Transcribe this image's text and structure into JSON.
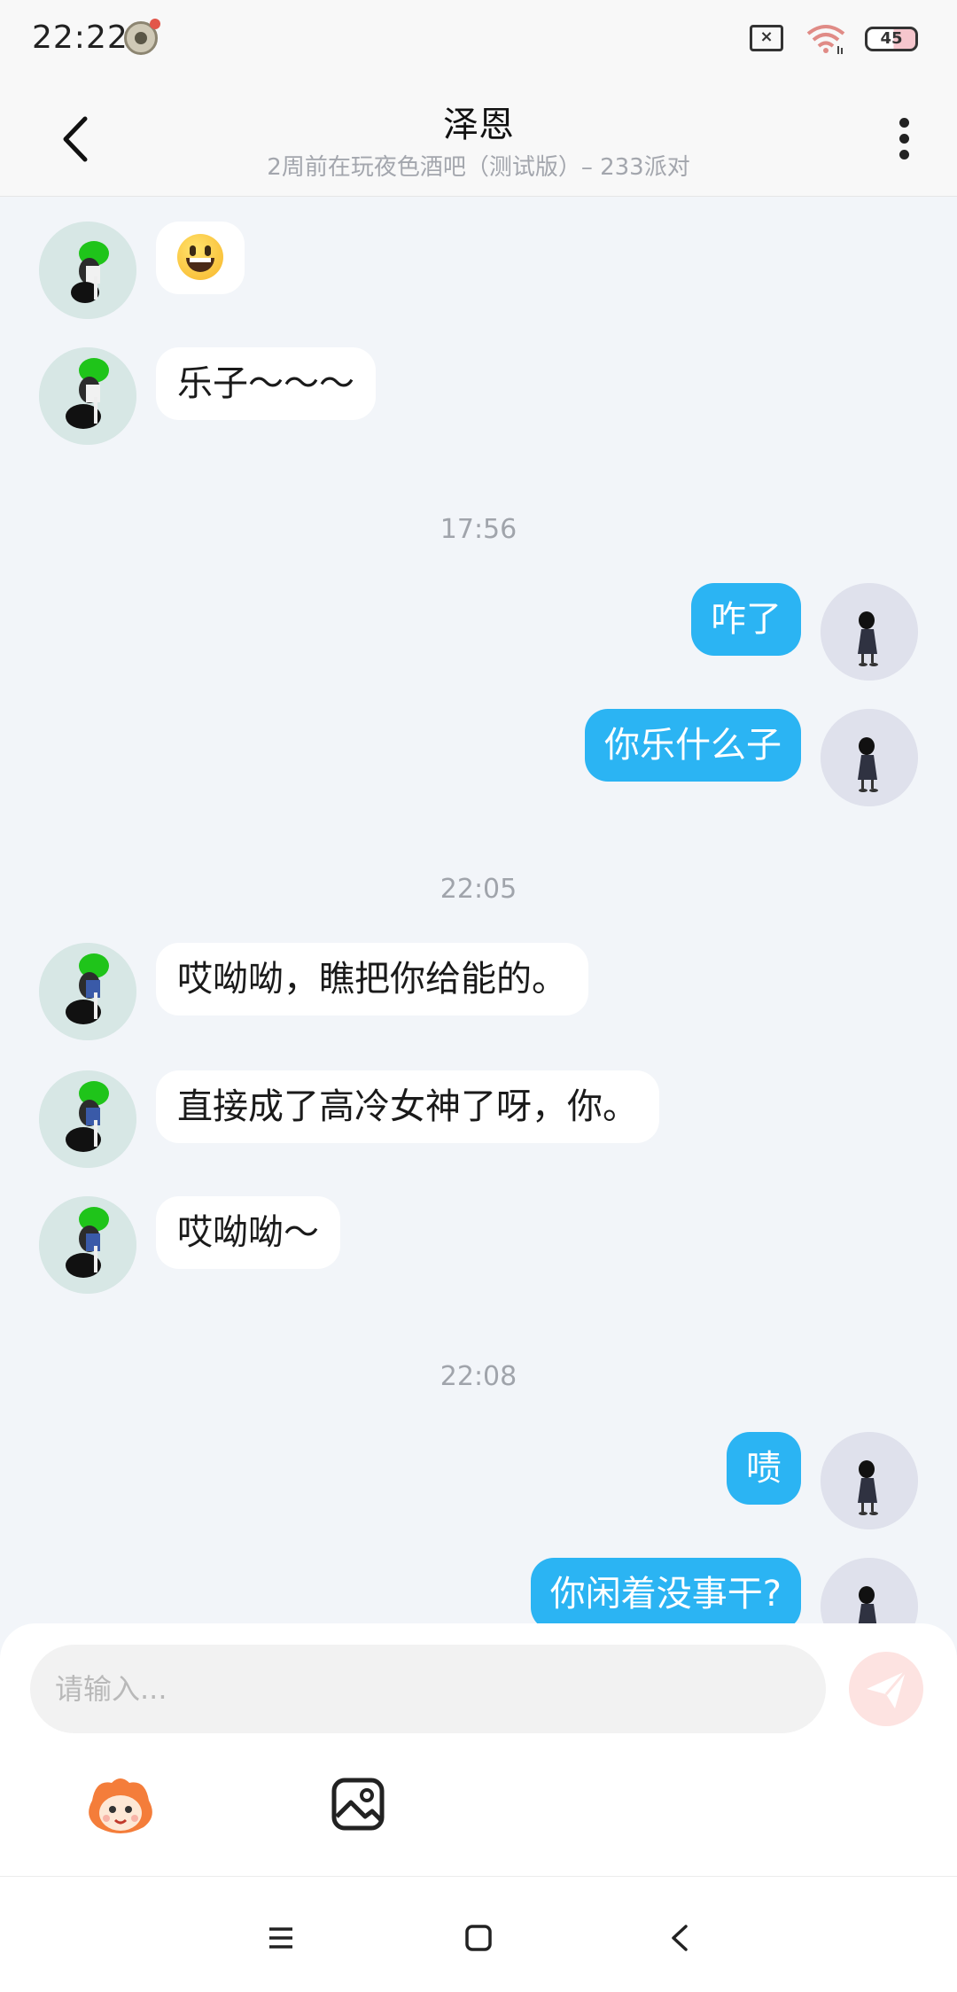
{
  "status_bar": {
    "time": "22:22",
    "battery": "45",
    "sim": "×"
  },
  "header": {
    "title": "泽恩",
    "subtitle": "2周前在玩夜色酒吧（测试版）– 233派对"
  },
  "messages": [
    {
      "side": "in",
      "kind": "emoji",
      "text": "",
      "icon": "grinning-face-emoji"
    },
    {
      "side": "in",
      "kind": "text",
      "text": "乐子～～～"
    },
    {
      "kind": "time",
      "text": "17:56"
    },
    {
      "side": "out",
      "kind": "text",
      "text": "咋了"
    },
    {
      "side": "out",
      "kind": "text",
      "text": "你乐什么子"
    },
    {
      "kind": "time",
      "text": "22:05"
    },
    {
      "side": "in",
      "kind": "text",
      "text": "哎呦呦，瞧把你给能的。"
    },
    {
      "side": "in",
      "kind": "text",
      "text": "直接成了高冷女神了呀，你。"
    },
    {
      "side": "in",
      "kind": "text",
      "text": "哎呦呦～"
    },
    {
      "kind": "time",
      "text": "22:08"
    },
    {
      "side": "out",
      "kind": "text",
      "text": "啧"
    },
    {
      "side": "out",
      "kind": "text",
      "text": "你闲着没事干?"
    }
  ],
  "composer": {
    "placeholder": "请输入...",
    "send_icon": "paper-plane-icon",
    "emoji_icon": "mascot-emoji-icon",
    "image_icon": "image-icon"
  },
  "nav": {
    "menu_icon": "menu-icon",
    "home_icon": "home-icon",
    "back_icon": "back-icon"
  },
  "colors": {
    "outgoing_bubble": "#2bb4f3",
    "incoming_bubble": "#ffffff",
    "background": "#f2f5f9",
    "send_button": "#fde3e1"
  }
}
